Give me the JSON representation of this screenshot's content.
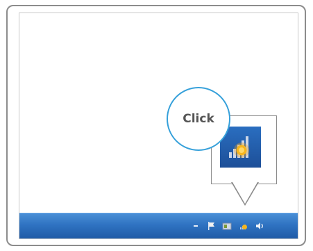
{
  "callout": {
    "label": "Click"
  },
  "tray": {
    "icons": [
      "show-hidden-icon",
      "action-center-flag-icon",
      "power-icon",
      "network-warning-icon",
      "volume-icon"
    ]
  },
  "colors": {
    "taskbar": "#2f73c2",
    "bubble_border": "#35a0da",
    "warning_badge": "#f6b51e"
  }
}
